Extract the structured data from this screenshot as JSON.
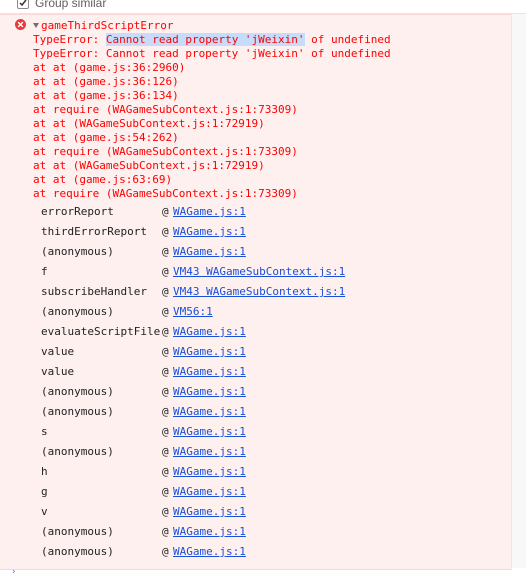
{
  "toolbar": {
    "group_similar_label": "Group similar",
    "group_similar_checked": true
  },
  "error": {
    "title": "gameThirdScriptError",
    "message_prefix": "TypeError: ",
    "message_highlight": "Cannot read property 'jWeixin'",
    "message_suffix": " of undefined",
    "lines": [
      "TypeError: Cannot read property 'jWeixin' of undefined",
      "at at (game.js:36:2960)",
      "at at (game.js:36:126)",
      "at at (game.js:36:134)",
      "at require (WAGameSubContext.js:1:73309)",
      "at at (WAGameSubContext.js:1:72919)",
      "at at (game.js:54:262)",
      "at require (WAGameSubContext.js:1:73309)",
      "at at (WAGameSubContext.js:1:72919)",
      "at at (game.js:63:69)",
      "at require (WAGameSubContext.js:1:73309)"
    ]
  },
  "stack": [
    {
      "fn": "errorReport",
      "at": "@",
      "link": "WAGame.js:1"
    },
    {
      "fn": "thirdErrorReport",
      "at": "@",
      "link": "WAGame.js:1"
    },
    {
      "fn": "(anonymous)",
      "at": "@",
      "link": "WAGame.js:1"
    },
    {
      "fn": "f",
      "at": "@",
      "link": "VM43 WAGameSubContext.js:1"
    },
    {
      "fn": "subscribeHandler",
      "at": "@",
      "link": "VM43 WAGameSubContext.js:1"
    },
    {
      "fn": "(anonymous)",
      "at": "@",
      "link": "VM56:1"
    },
    {
      "fn": "evaluateScriptFile",
      "at": "@",
      "link": "WAGame.js:1"
    },
    {
      "fn": "value",
      "at": "@",
      "link": "WAGame.js:1"
    },
    {
      "fn": "value",
      "at": "@",
      "link": "WAGame.js:1"
    },
    {
      "fn": "(anonymous)",
      "at": "@",
      "link": "WAGame.js:1"
    },
    {
      "fn": "(anonymous)",
      "at": "@",
      "link": "WAGame.js:1"
    },
    {
      "fn": "s",
      "at": "@",
      "link": "WAGame.js:1"
    },
    {
      "fn": "(anonymous)",
      "at": "@",
      "link": "WAGame.js:1"
    },
    {
      "fn": "h",
      "at": "@",
      "link": "WAGame.js:1"
    },
    {
      "fn": "g",
      "at": "@",
      "link": "WAGame.js:1"
    },
    {
      "fn": "v",
      "at": "@",
      "link": "WAGame.js:1"
    },
    {
      "fn": "(anonymous)",
      "at": "@",
      "link": "WAGame.js:1"
    },
    {
      "fn": "(anonymous)",
      "at": "@",
      "link": "WAGame.js:1"
    }
  ],
  "icons": {
    "error": "error-circle-icon",
    "expand": "expand-triangle-icon",
    "checkbox": "checkbox-checked-icon"
  },
  "colors": {
    "error_text": "#ff0000",
    "error_background": "#fff0f0",
    "link": "#1a4fd8",
    "highlight": "#c6dcfa"
  }
}
